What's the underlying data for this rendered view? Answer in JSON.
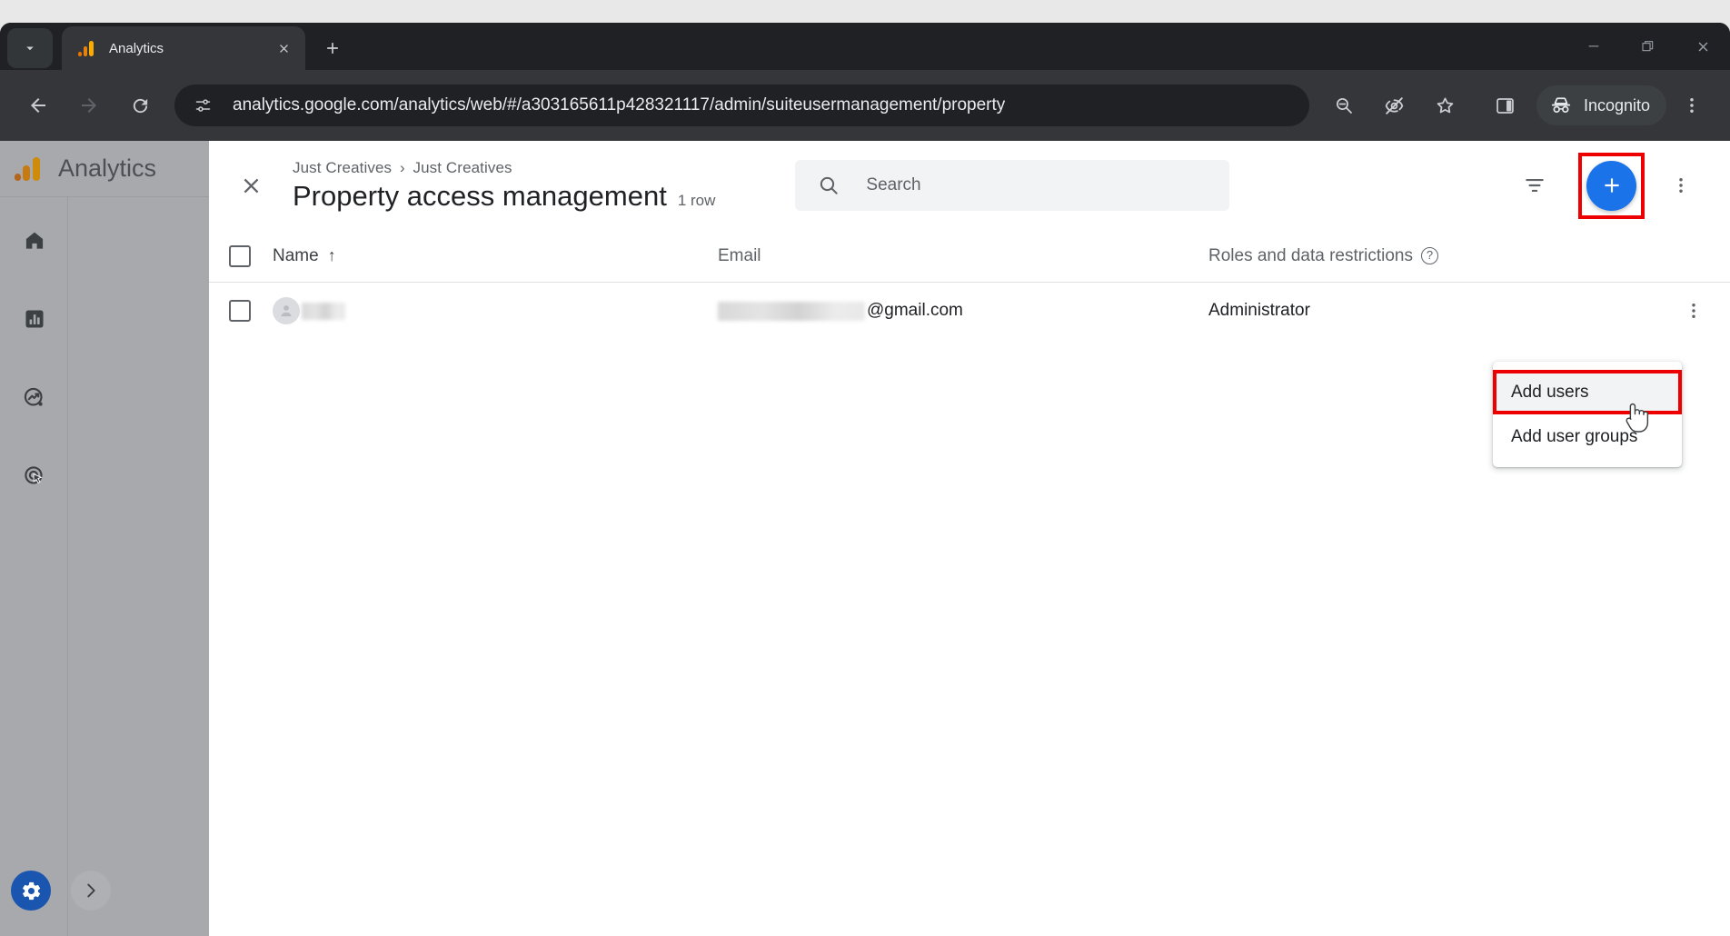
{
  "browser": {
    "tab": {
      "title": "Analytics",
      "favicon": "google-analytics-icon"
    },
    "tab_list_icon": "chevron-down-icon",
    "new_tab_icon": "plus-icon",
    "window_controls": {
      "minimize": "minimize-icon",
      "maximize": "restore-icon",
      "close": "close-icon"
    },
    "nav": {
      "back_icon": "arrow-back-icon",
      "forward_icon": "arrow-forward-icon",
      "reload_icon": "reload-icon",
      "site_info_icon": "site-settings-icon",
      "url": "analytics.google.com/analytics/web/#/a303165611p428321117/admin/suiteusermanagement/property",
      "zoom_out_icon": "zoom-out-icon",
      "tracking_protection_icon": "eye-off-icon",
      "bookmark_icon": "star-icon",
      "side_panel_icon": "side-panel-icon",
      "profile_label": "Incognito",
      "profile_icon": "incognito-icon",
      "menu_icon": "kebab-menu-icon"
    }
  },
  "ga_shell": {
    "brand": "Analytics",
    "brand_icon": "google-analytics-logo",
    "rail": [
      {
        "name": "home",
        "icon": "home-icon"
      },
      {
        "name": "reports",
        "icon": "bar-chart-icon"
      },
      {
        "name": "explore",
        "icon": "explore-trend-icon"
      },
      {
        "name": "advertising",
        "icon": "advertising-target-icon"
      }
    ],
    "settings_icon": "gear-icon",
    "expand_icon": "chevron-right-icon"
  },
  "panel": {
    "close_icon": "close-icon",
    "breadcrumb": {
      "account": "Just Creatives",
      "separator": "›",
      "property": "Just Creatives"
    },
    "title": "Property access management",
    "row_count": "1 row",
    "search": {
      "placeholder": "Search",
      "icon": "search-icon",
      "value": ""
    },
    "actions": {
      "filter_icon": "filter-icon",
      "add_icon": "plus-icon",
      "more_icon": "kebab-menu-icon"
    },
    "table": {
      "select_all": "select-all-checkbox",
      "columns": [
        {
          "label": "Name",
          "sort": "↑"
        },
        {
          "label": "Email"
        },
        {
          "label": "Roles and data restrictions",
          "help": "?"
        }
      ],
      "rows": [
        {
          "checkbox": "row-checkbox",
          "avatar": "person-avatar-icon",
          "name": "",
          "email_prefix": "",
          "email_domain": "@gmail.com",
          "roles": "Administrator",
          "row_menu_icon": "kebab-menu-icon"
        }
      ]
    },
    "menu": {
      "items": [
        {
          "label": "Add users",
          "hovered": true
        },
        {
          "label": "Add user groups",
          "hovered": false
        }
      ]
    }
  },
  "highlight_color": "#ef0000",
  "accent_color": "#1a73e8"
}
